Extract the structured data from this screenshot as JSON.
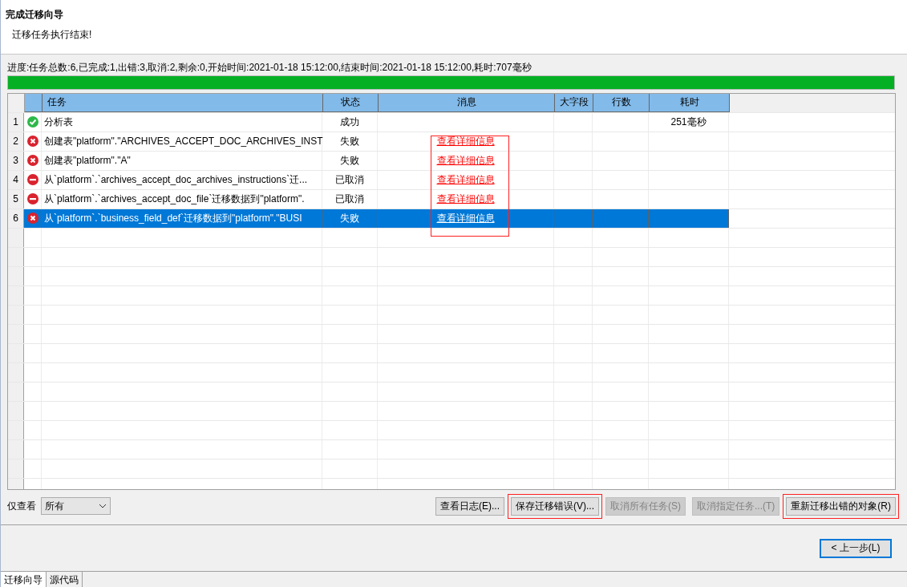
{
  "header": {
    "title": "完成迁移向导",
    "subtitle": "迁移任务执行结束!"
  },
  "progress": {
    "text": "进度:任务总数:6,已完成:1,出错:3,取消:2,剩余:0,开始时间:2021-01-18 15:12:00,结束时间:2021-01-18 15:12:00,耗时:707毫秒",
    "level": 1
  },
  "table": {
    "columns": [
      "任务",
      "状态",
      "消息",
      "大字段",
      "行数",
      "耗时"
    ],
    "rows": [
      {
        "number": "1",
        "kind": "success",
        "task": "分析表",
        "status": "成功",
        "message": "",
        "time": "251毫秒",
        "selected": false,
        "annotated": false
      },
      {
        "number": "2",
        "kind": "error",
        "task": "创建表\"platform\".\"ARCHIVES_ACCEPT_DOC_ARCHIVES_INST",
        "status": "失败",
        "message": "查看详细信息",
        "time": "",
        "selected": false,
        "annotated": true
      },
      {
        "number": "3",
        "kind": "error",
        "task": "创建表\"platform\".\"A\"",
        "status": "失败",
        "message": "查看详细信息",
        "time": "",
        "selected": false,
        "annotated": true
      },
      {
        "number": "4",
        "kind": "cancelled",
        "task": "从`platform`.`archives_accept_doc_archives_instructions`迁...",
        "status": "已取消",
        "message": "查看详细信息",
        "time": "",
        "selected": false,
        "annotated": true
      },
      {
        "number": "5",
        "kind": "cancelled",
        "task": "从`platform`.`archives_accept_doc_file`迁移数据到\"platform\".",
        "status": "已取消",
        "message": "查看详细信息",
        "time": "",
        "selected": false,
        "annotated": true
      },
      {
        "number": "6",
        "kind": "error",
        "task": "从`platform`.`business_field_def`迁移数据到\"platform\".\"BUSI",
        "status": "失败",
        "message": "查看详细信息",
        "time": "",
        "selected": true,
        "annotated": true
      }
    ]
  },
  "filter": {
    "label": "仅查看",
    "value": "所有"
  },
  "actions": [
    {
      "label": "查看日志(E)...",
      "disabled": false,
      "annotated": false
    },
    {
      "label": "保存迁移错误(V)...",
      "disabled": false,
      "annotated": true
    },
    {
      "label": "取消所有任务(S)",
      "disabled": true,
      "annotated": false
    },
    {
      "label": "取消指定任务...(T)",
      "disabled": true,
      "annotated": false
    },
    {
      "label": "重新迁移出错的对象(R)",
      "disabled": false,
      "annotated": true
    }
  ],
  "back_button": "< 上一步(L)",
  "tabs": [
    {
      "label": "迁移向导",
      "selected": true
    },
    {
      "label": "源代码",
      "selected": false
    }
  ]
}
